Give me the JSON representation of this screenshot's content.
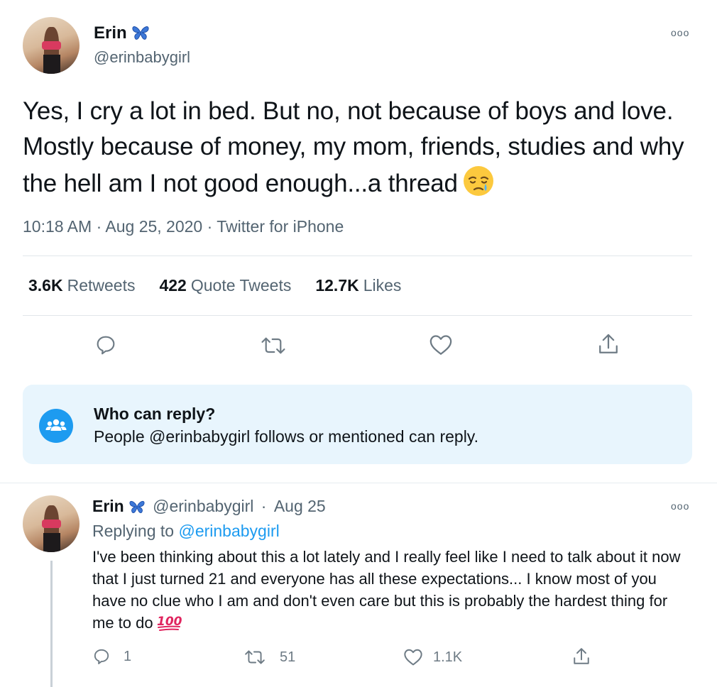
{
  "tweet": {
    "author_name": "Erin",
    "author_handle": "@erinbabygirl",
    "more_icon": "ooo",
    "text": "Yes, I cry a lot in bed. But no, not because of boys and love. Mostly because of money, my mom, friends, studies and why the hell am I not good enough...a thread",
    "emoji": "crying-face-emoji",
    "time": "10:18 AM",
    "sep1": "·",
    "date": "Aug 25, 2020",
    "sep2": "·",
    "source": "Twitter for iPhone",
    "stats": {
      "retweets_count": "3.6K",
      "retweets_label": "Retweets",
      "quotes_count": "422",
      "quotes_label": "Quote Tweets",
      "likes_count": "12.7K",
      "likes_label": "Likes"
    }
  },
  "reply_settings": {
    "title": "Who can reply?",
    "subtitle": "People @erinbabygirl follows or mentioned can reply."
  },
  "reply": {
    "author_name": "Erin",
    "author_handle": "@erinbabygirl",
    "sep": "·",
    "date": "Aug 25",
    "more_icon": "ooo",
    "replying_prefix": "Replying to",
    "replying_handle": "@erinbabygirl",
    "text": "I've been thinking about this a lot lately and I really feel like I need to talk about it now that I just turned 21 and everyone has all these expectations... I know most of you have no clue who I am and don't even care but this is probably the hardest thing for me to do",
    "emoji": "hundred-points-emoji",
    "reply_count": "1",
    "retweet_count": "51",
    "like_count": "1.1K"
  },
  "colors": {
    "accent": "#1d9bf0",
    "secondary_text": "#536471",
    "reply_box_bg": "#e8f5fd"
  }
}
